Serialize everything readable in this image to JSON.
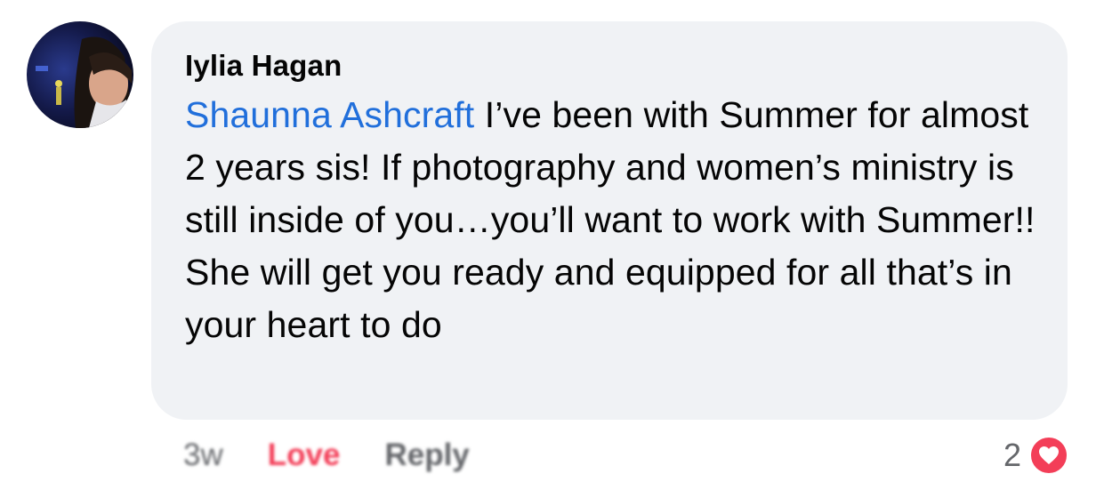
{
  "comment": {
    "author": "Iylia Hagan",
    "mention": "Shaunna Ashcraft",
    "text": " I’ve been with Summer for almost 2 years sis! If photography and women’s ministry is still inside of you…you’ll want to work with Summer!! She will get you ready and equipped for all that’s in your heart to do"
  },
  "actions": {
    "time": "3w",
    "love": "Love",
    "reply": "Reply"
  },
  "reactions": {
    "count": "2",
    "icon": "heart-icon"
  },
  "colors": {
    "bubble": "#f0f2f5",
    "mention": "#216fdb",
    "love": "#f33e58",
    "muted": "#65676b"
  }
}
